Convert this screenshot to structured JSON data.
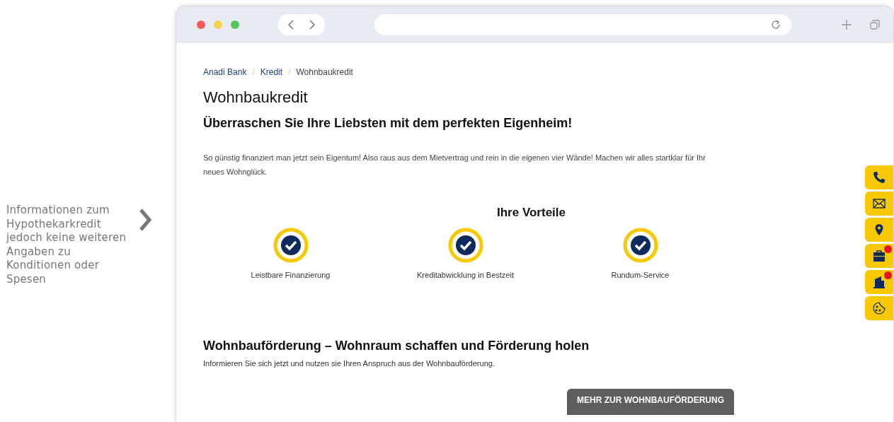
{
  "annotation": {
    "text": "Informationen zum Hypothekarkredit jedoch keine weiteren Angaben zu Konditionen oder Spesen"
  },
  "breadcrumb": [
    {
      "label": "Anadi Bank",
      "current": false
    },
    {
      "label": "Kredit",
      "current": false
    },
    {
      "label": "Wohnbaukredit",
      "current": true
    }
  ],
  "breadcrumb_separator": "/",
  "title": "Wohnbaukredit",
  "subtitle": "Überraschen Sie Ihre Liebsten mit dem perfekten Eigenheim!",
  "intro": "So günstig finanziert man jetzt sein Eigentum! Also raus aus dem Mietvertrag und rein in die eigenen vier Wände! Machen wir alles startklar für Ihr neues Wohnglück.",
  "benefits": {
    "title": "Ihre Vorteile",
    "items": [
      "Leistbare Finanzierung",
      "Kreditabwicklung in Bestzeit",
      "Rundum-Service"
    ]
  },
  "section": {
    "title": "Wohnbauförderung – Wohnraum schaffen und Förderung holen",
    "text": "Informieren Sie sich jetzt und nutzen sie Ihren Anspruch aus der Wohnbauförderung.",
    "button": "MEHR ZUR WOHNBAUFÖRDERUNG"
  },
  "side_buttons": [
    {
      "kind": "phone",
      "badge": false
    },
    {
      "kind": "mail",
      "badge": false
    },
    {
      "kind": "location",
      "badge": false
    },
    {
      "kind": "briefcase",
      "badge": true
    },
    {
      "kind": "building",
      "badge": true
    },
    {
      "kind": "cookie",
      "badge": false
    }
  ]
}
